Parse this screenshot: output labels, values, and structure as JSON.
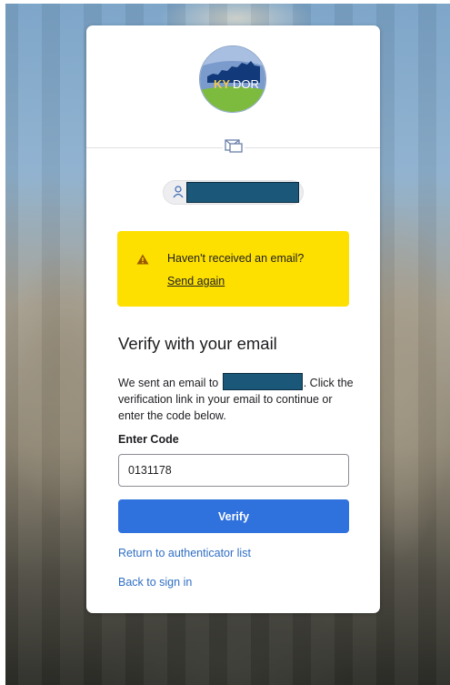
{
  "logo": {
    "text_left": "KY",
    "text_right": "DOR",
    "colors": {
      "sky": "#6d8fc2",
      "state": "#123a7a",
      "ground": "#7dbb3f",
      "text": "#ffffff",
      "accent": "#f2c94c"
    }
  },
  "icons": {
    "divider_icon": "mail-icon",
    "identifier_icon": "user-icon",
    "alert_icon": "warning-icon"
  },
  "identifier": {
    "value_redacted": true
  },
  "alert": {
    "title": "Haven't received an email?",
    "link": "Send again",
    "background": "#fee000"
  },
  "heading": "Verify with your email",
  "description": {
    "before": "We sent an email to ",
    "after": ". Click the verification link in your email to continue or enter the code below."
  },
  "code_field": {
    "label": "Enter Code",
    "value": "0131178"
  },
  "verify_button": {
    "label": "Verify",
    "color": "#2f71dd"
  },
  "links": {
    "return": "Return to authenticator list",
    "back": "Back to sign in"
  }
}
